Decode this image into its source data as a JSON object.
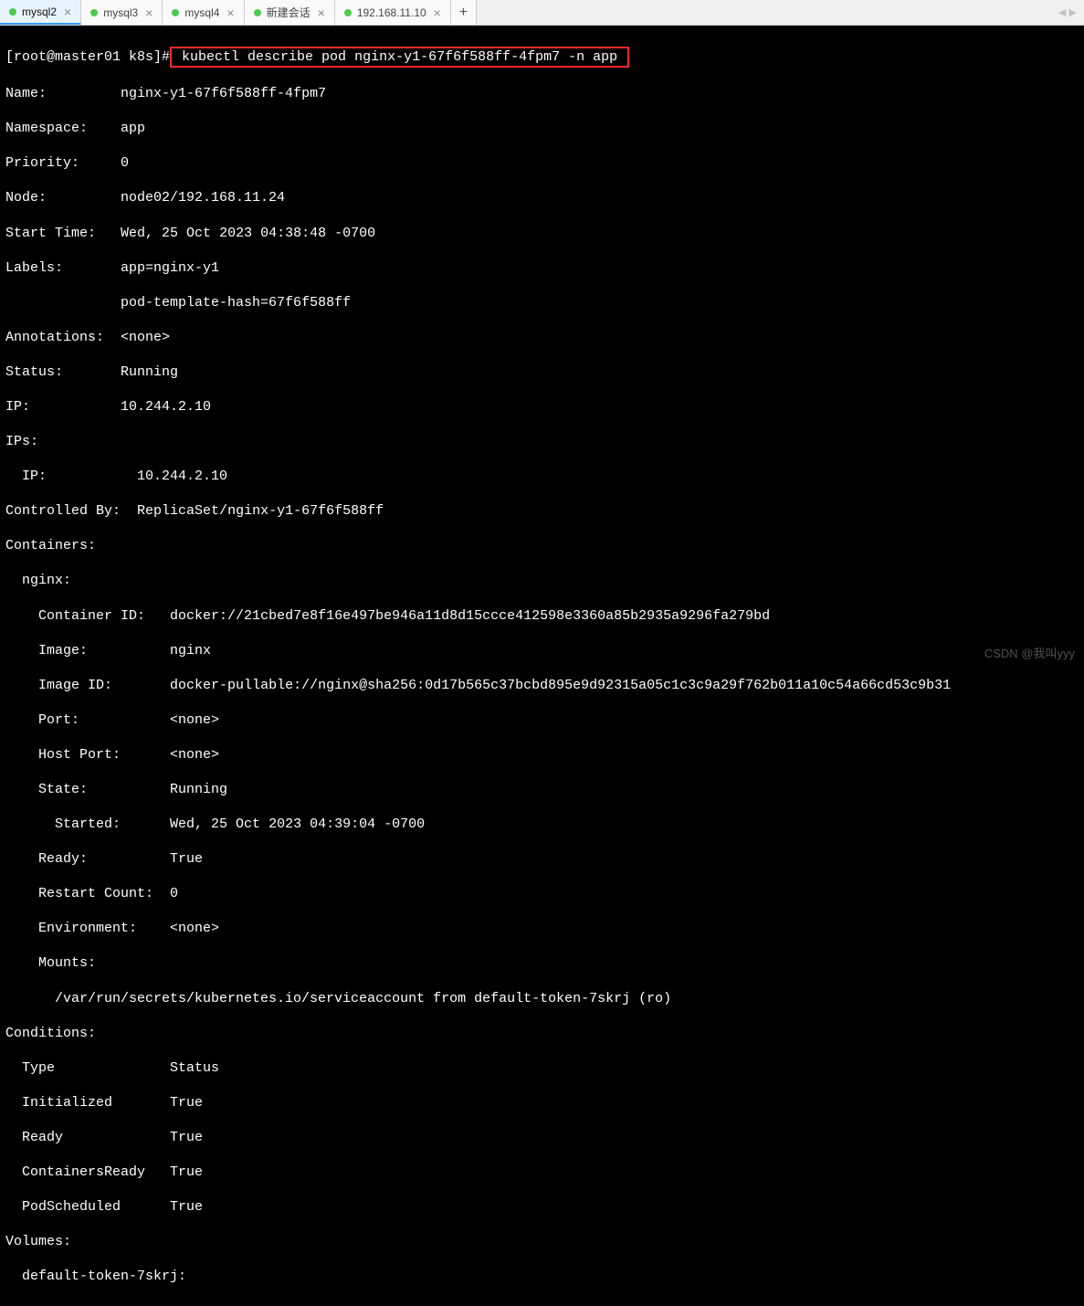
{
  "tabs": [
    {
      "label": "mysql2",
      "active": true
    },
    {
      "label": "mysql3",
      "active": false
    },
    {
      "label": "mysql4",
      "active": false
    },
    {
      "label": "新建会话",
      "active": false
    },
    {
      "label": "192.168.11.10",
      "active": false
    }
  ],
  "prompt": {
    "user_host": "[root@master01 k8s]#",
    "command": " kubectl describe pod nginx-y1-67f6f588ff-4fpm7 -n app "
  },
  "pod": {
    "name_label": "Name:",
    "name_value": "nginx-y1-67f6f588ff-4fpm7",
    "namespace_label": "Namespace:",
    "namespace_value": "app",
    "priority_label": "Priority:",
    "priority_value": "0",
    "node_label": "Node:",
    "node_value": "node02/192.168.11.24",
    "start_label": "Start Time:",
    "start_value": "Wed, 25 Oct 2023 04:38:48 -0700",
    "labels_label": "Labels:",
    "labels_value1": "app=nginx-y1",
    "labels_value2": "pod-template-hash=67f6f588ff",
    "ann_label": "Annotations:",
    "ann_value": "<none>",
    "status_label": "Status:",
    "status_value": "Running",
    "ip_label": "IP:",
    "ip_value": "10.244.2.10",
    "ips_label": "IPs:",
    "ips_sub_label": "  IP:",
    "ips_sub_value": "10.244.2.10",
    "ctrl_label": "Controlled By:",
    "ctrl_value": "ReplicaSet/nginx-y1-67f6f588ff",
    "containers_label": "Containers:",
    "container_name": "  nginx:",
    "cid_label": "    Container ID:",
    "cid_value": "docker://21cbed7e8f16e497be946a11d8d15ccce412598e3360a85b2935a9296fa279bd",
    "img_label": "    Image:",
    "img_value": "nginx",
    "imgid_label": "    Image ID:",
    "imgid_value": "docker-pullable://nginx@sha256:0d17b565c37bcbd895e9d92315a05c1c3c9a29f762b011a10c54a66cd53c9b31",
    "port_label": "    Port:",
    "port_value": "<none>",
    "hport_label": "    Host Port:",
    "hport_value": "<none>",
    "state_label": "    State:",
    "state_value": "Running",
    "started_label": "      Started:",
    "started_value": "Wed, 25 Oct 2023 04:39:04 -0700",
    "ready_label": "    Ready:",
    "ready_value": "True",
    "rc_label": "    Restart Count:",
    "rc_value": "0",
    "env_label": "    Environment:",
    "env_value": "<none>",
    "mounts_label": "    Mounts:",
    "mounts_value": "      /var/run/secrets/kubernetes.io/serviceaccount from default-token-7skrj (ro)",
    "cond_label": "Conditions:",
    "cond_type": "  Type",
    "cond_status": "Status",
    "cond_init": "  Initialized",
    "cond_init_v": "True",
    "cond_ready": "  Ready",
    "cond_ready_v": "True",
    "cond_cready": "  ContainersReady",
    "cond_cready_v": "True",
    "cond_sched": "  PodScheduled",
    "cond_sched_v": "True",
    "vol_label": "Volumes:",
    "vol_name": "  default-token-7skrj:"
  },
  "watermark": "CSDN @我叫yyy"
}
